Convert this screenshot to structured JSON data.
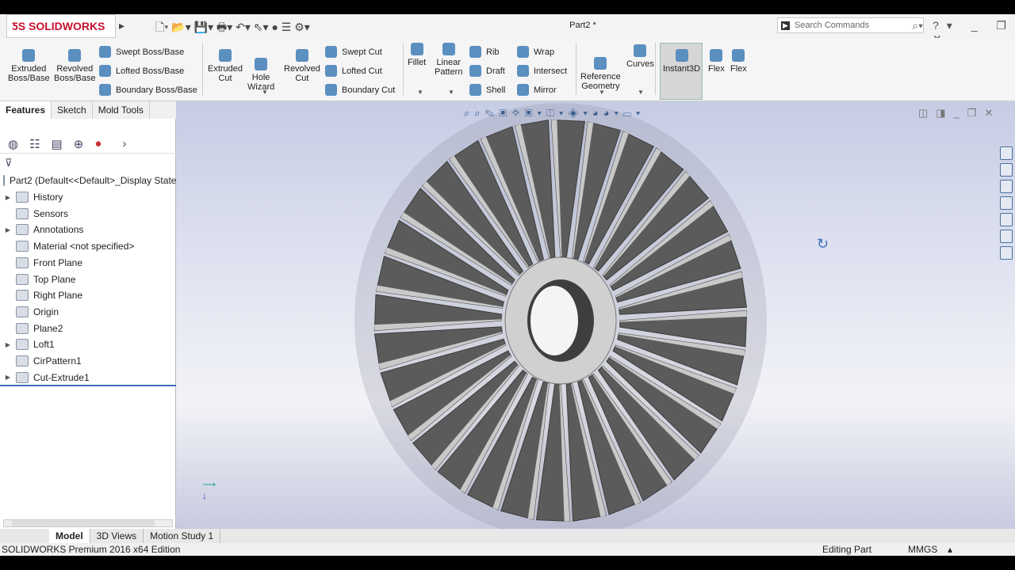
{
  "app": {
    "logo": "SOLIDWORKS",
    "doc_title": "Part2 *",
    "search_placeholder": "Search Commands"
  },
  "ribbon": {
    "large": [
      {
        "label": "Extruded\nBoss/Base"
      },
      {
        "label": "Revolved\nBoss/Base"
      },
      {
        "label": "Extruded\nCut"
      },
      {
        "label": "Hole\nWizard"
      },
      {
        "label": "Revolved\nCut"
      },
      {
        "label": "Fillet"
      },
      {
        "label": "Linear\nPattern"
      },
      {
        "label": "Reference\nGeometry"
      },
      {
        "label": "Curves"
      },
      {
        "label": "Instant3D"
      },
      {
        "label": "Flex"
      },
      {
        "label": "Flex"
      }
    ],
    "small": [
      "Swept Boss/Base",
      "Lofted Boss/Base",
      "Boundary Boss/Base",
      "Swept Cut",
      "Lofted Cut",
      "Boundary Cut",
      "Rib",
      "Draft",
      "Shell",
      "Wrap",
      "Intersect",
      "Mirror"
    ]
  },
  "tabs": [
    "Features",
    "Sketch",
    "Mold Tools"
  ],
  "tree": {
    "root": "Part2  (Default<<Default>_Display State",
    "items": [
      "History",
      "Sensors",
      "Annotations",
      "Material <not specified>",
      "Front Plane",
      "Top Plane",
      "Right Plane",
      "Origin",
      "Plane2",
      "Loft1",
      "CirPattern1",
      "Cut-Extrude1"
    ]
  },
  "bottom_tabs": [
    "Model",
    "3D Views",
    "Motion Study 1"
  ],
  "status": {
    "edition": "SOLIDWORKS Premium 2016 x64 Edition",
    "mode": "Editing Part",
    "units": "MMGS"
  },
  "colors": {
    "blade": "#5b5b5b",
    "blade_edge": "#c9c9c9",
    "hub": "#d0d0d0"
  }
}
